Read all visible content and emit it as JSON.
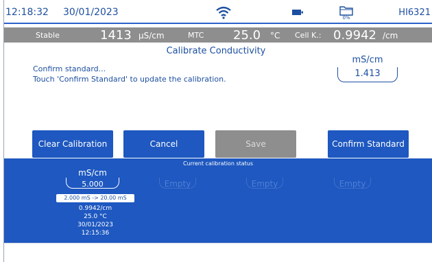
{
  "status_bar": {
    "time": "12:18:32",
    "date": "30/01/2023",
    "wifi_icon": "wifi-icon",
    "battery_icon": "battery-icon",
    "storage_icon": "folder-icon",
    "storage_percent": "0%",
    "model": "HI6321"
  },
  "reading": {
    "state": "Stable",
    "value": "1413",
    "unit": "µS/cm",
    "temp_mode": "MTC",
    "temperature": "25.0",
    "temp_unit": "°C",
    "cell_k_label": "Cell K.:",
    "cell_k_value": "0.9942",
    "cell_k_unit": "/cm"
  },
  "screen": {
    "title": "Calibrate Conductivity",
    "message_line1": "Confirm standard...",
    "message_line2": "Touch 'Confirm Standard' to update the calibration.",
    "standard_unit": "mS/cm",
    "standard_value": "1.413"
  },
  "buttons": {
    "clear": "Clear Calibration",
    "cancel": "Cancel",
    "save": "Save",
    "confirm": "Confirm Standard"
  },
  "calibration_status": {
    "title": "Current calibration status",
    "slot1": {
      "unit": "mS/cm",
      "value": "5.000",
      "range": "2.000 mS -> 20.00 mS",
      "cell_constant": "0.9942/cm",
      "temperature": "25.0 °C",
      "date": "30/01/2023",
      "time": "12:15:36"
    },
    "slot2": "Empty",
    "slot3": "Empty",
    "slot4": "Empty"
  },
  "colors": {
    "accent": "#1e58c0",
    "text": "#1c4fa0",
    "reading_bar": "#8e8e8e"
  }
}
